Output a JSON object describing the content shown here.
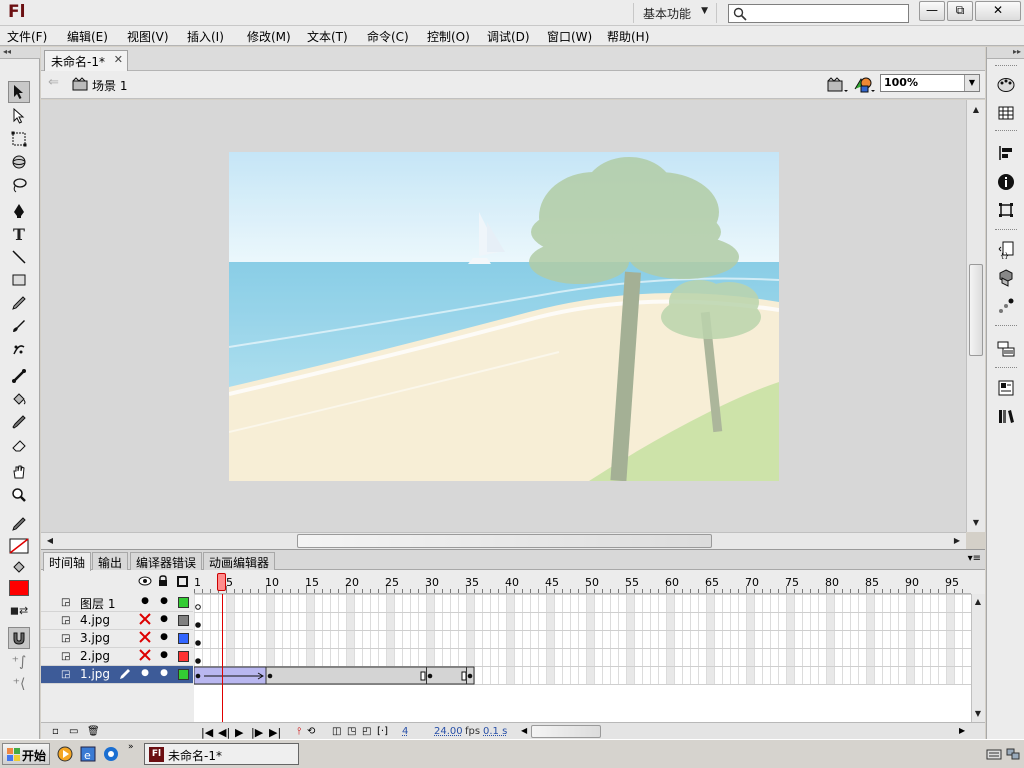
{
  "app": {
    "logo": "Fl",
    "workspace": "基本功能"
  },
  "window_buttons": [
    "—",
    "⧉",
    "✕"
  ],
  "menu": [
    "文件(F)",
    "编辑(E)",
    "视图(V)",
    "插入(I)",
    "修改(M)",
    "文本(T)",
    "命令(C)",
    "控制(O)",
    "调试(D)",
    "窗口(W)",
    "帮助(H)"
  ],
  "document": {
    "tab_title": "未命名-1*",
    "scene_label": "场景 1",
    "zoom": "100%"
  },
  "timeline": {
    "tabs": [
      "时间轴",
      "输出",
      "编译器错误",
      "动画编辑器"
    ],
    "ruler": [
      "1",
      "5",
      "10",
      "15",
      "20",
      "25",
      "30",
      "35",
      "40",
      "45",
      "50",
      "55",
      "60",
      "65",
      "70",
      "75",
      "80",
      "85",
      "90",
      "95"
    ],
    "current_frame": 4,
    "layers": [
      {
        "name": "图层 1",
        "hidden": false,
        "color": "#33cc33",
        "selected": false
      },
      {
        "name": "4.jpg",
        "hidden": true,
        "color": "#808080",
        "selected": false
      },
      {
        "name": "3.jpg",
        "hidden": true,
        "color": "#3366ff",
        "selected": false
      },
      {
        "name": "2.jpg",
        "hidden": true,
        "color": "#ff3333",
        "selected": false
      },
      {
        "name": "1.jpg",
        "hidden": false,
        "color": "#33cc33",
        "selected": true
      }
    ],
    "status": {
      "frame": "4",
      "fps": "24.00",
      "fps_unit": "fps",
      "time": "0.1 s"
    }
  },
  "taskbar": {
    "start": "开始",
    "task": "未命名-1*"
  },
  "icons": [
    "search-icon",
    "arrow-tool-icon",
    "subselect-tool-icon",
    "free-transform-icon",
    "3d-rotation-icon",
    "lasso-icon",
    "pen-icon",
    "text-tool-icon",
    "line-tool-icon",
    "rectangle-tool-icon",
    "pencil-icon",
    "brush-icon",
    "deco-icon",
    "bone-icon",
    "paint-bucket-icon",
    "eyedropper-icon",
    "eraser-icon",
    "hand-icon",
    "zoom-icon",
    "color-palette-icon",
    "info-icon",
    "library-icon"
  ]
}
